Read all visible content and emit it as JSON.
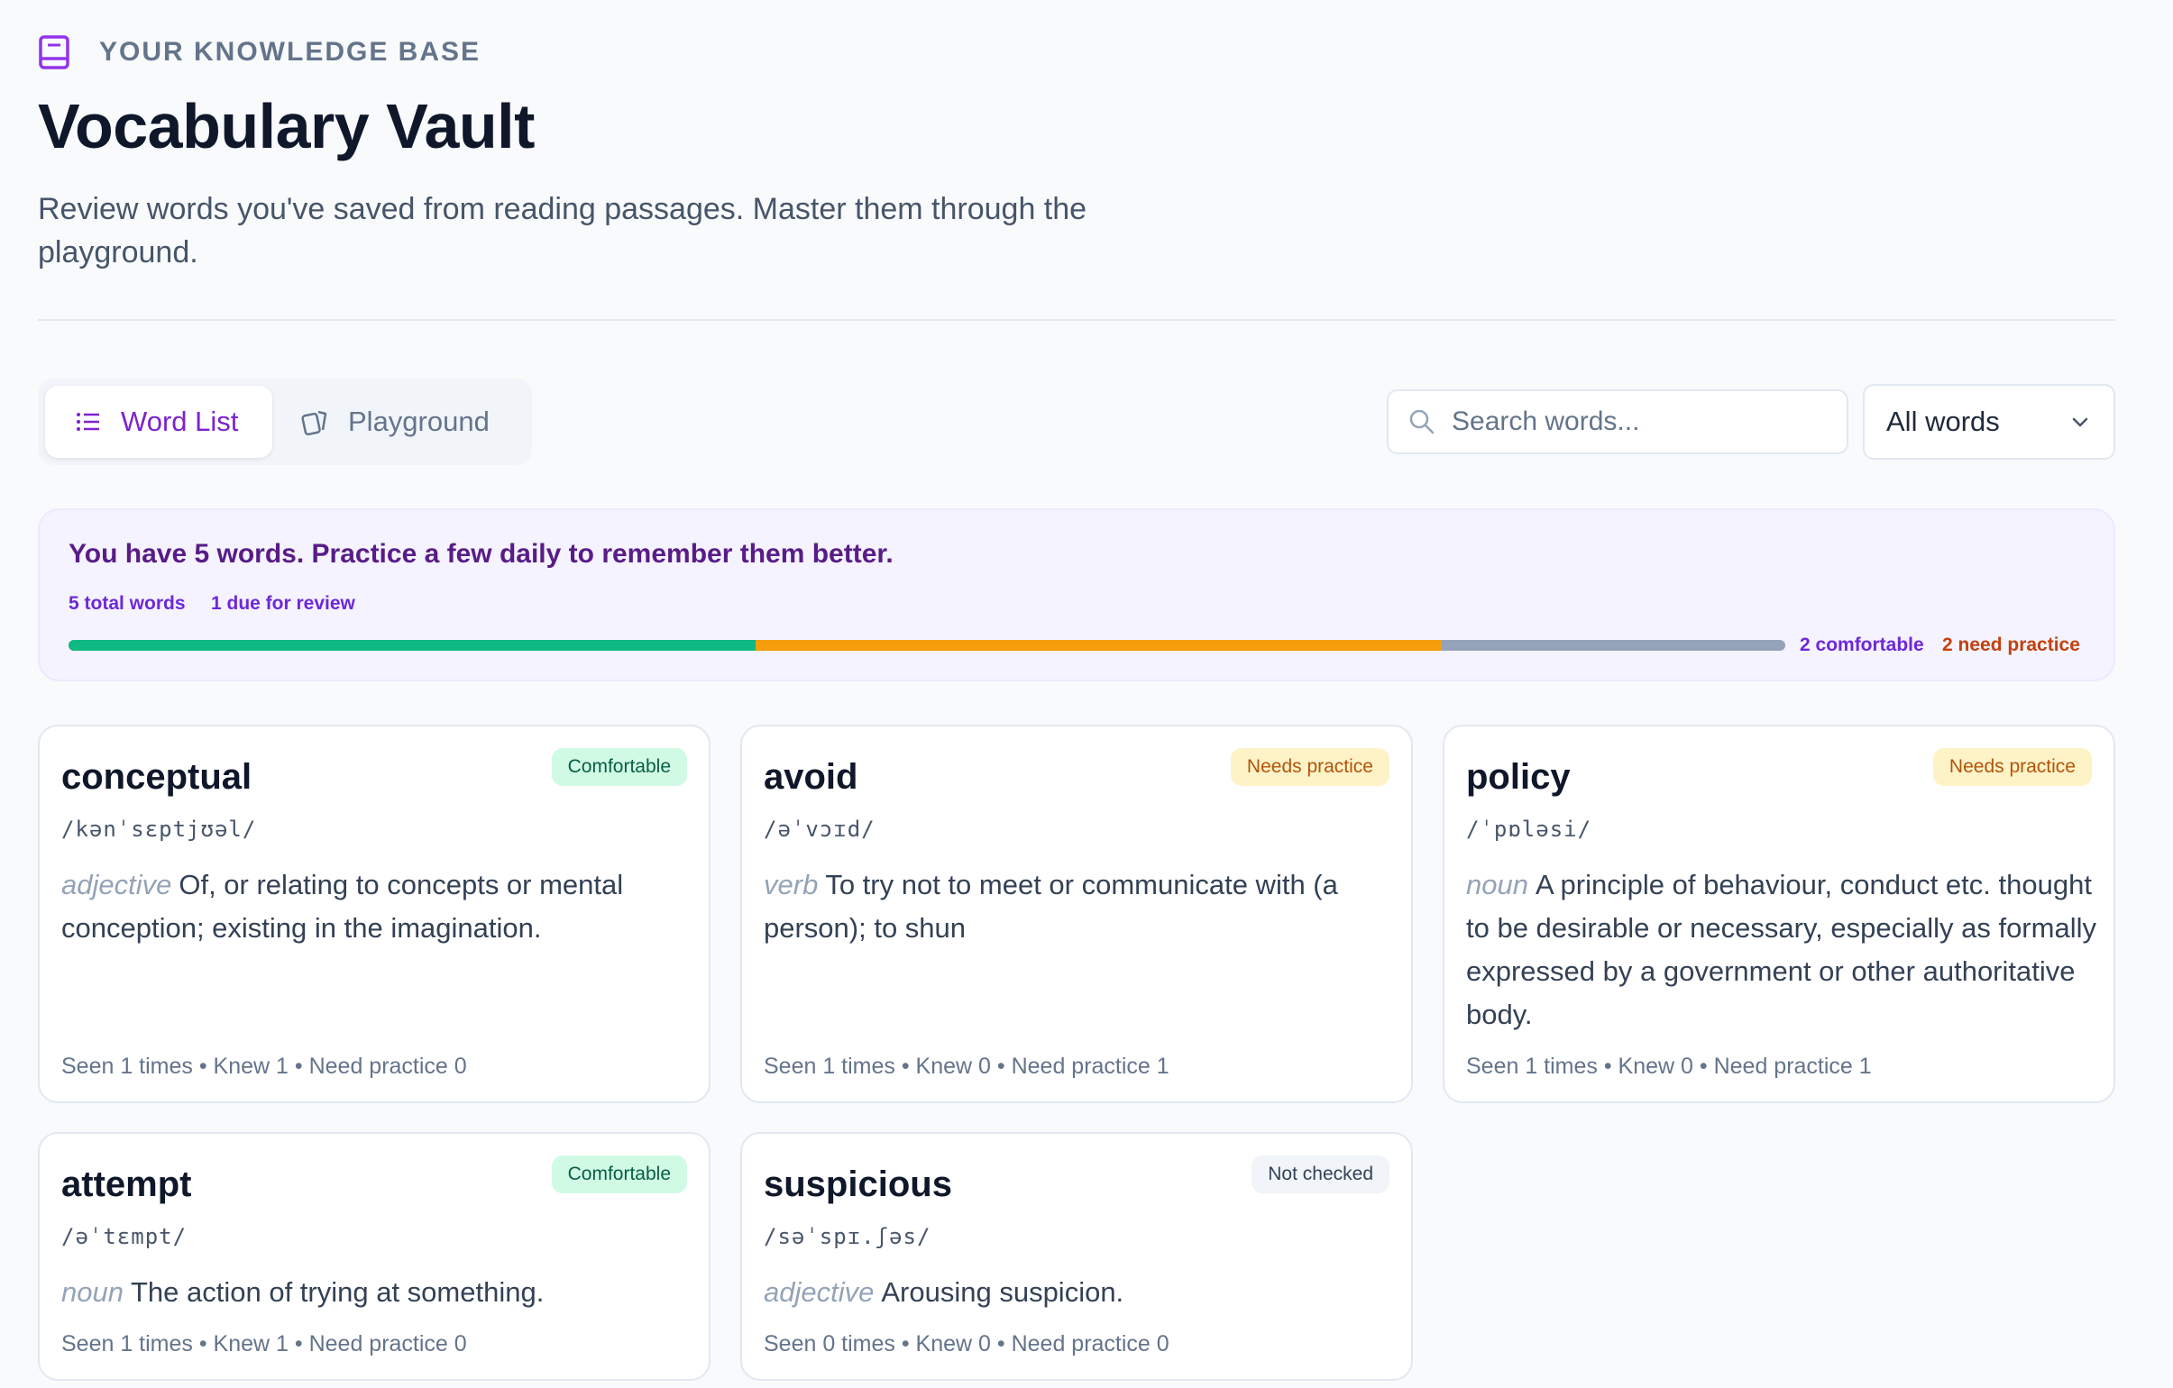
{
  "header": {
    "eyebrow": "YOUR KNOWLEDGE BASE",
    "title": "Vocabulary Vault",
    "subtitle": "Review words you've saved from reading passages. Master them through the playground."
  },
  "tabs": [
    {
      "label": "Word List",
      "icon": "list-icon",
      "active": true
    },
    {
      "label": "Playground",
      "icon": "cards-icon",
      "active": false
    }
  ],
  "search": {
    "placeholder": "Search words..."
  },
  "filter": {
    "selected": "All words"
  },
  "summary": {
    "message": "You have 5 words. Practice a few daily to remember them better.",
    "total_label": "5 total words",
    "due_label": "1 due for review",
    "comfortable_label": "2 comfortable",
    "need_practice_label": "2 need practice",
    "progress": {
      "comfortable": 2,
      "need_practice": 2,
      "not_checked": 1,
      "total": 5
    }
  },
  "colors": {
    "accent": "#7e22ce",
    "comfortable": "#10b981",
    "need_practice": "#f59e0b",
    "not_checked": "#94a3b8"
  },
  "cards": [
    {
      "word": "conceptual",
      "ipa": "/kənˈsɛptjʊəl/",
      "pos": "adjective",
      "definition": "Of, or relating to concepts or mental conception; existing in the imagination.",
      "status": "Comfortable",
      "meta": "Seen 1 times • Knew 1 • Need practice 0"
    },
    {
      "word": "avoid",
      "ipa": "/əˈvɔɪd/",
      "pos": "verb",
      "definition": "To try not to meet or communicate with (a person); to shun",
      "status": "Needs practice",
      "meta": "Seen 1 times • Knew 0 • Need practice 1"
    },
    {
      "word": "policy",
      "ipa": "/ˈpɒləsi/",
      "pos": "noun",
      "definition": "A principle of behaviour, conduct etc. thought to be desirable or necessary, especially as formally expressed by a government or other authoritative body.",
      "status": "Needs practice",
      "meta": "Seen 1 times • Knew 0 • Need practice 1"
    },
    {
      "word": "attempt",
      "ipa": "/əˈtɛmpt/",
      "pos": "noun",
      "definition": "The action of trying at something.",
      "status": "Comfortable",
      "meta": "Seen 1 times • Knew 1 • Need practice 0"
    },
    {
      "word": "suspicious",
      "ipa": "/səˈspɪ.ʃəs/",
      "pos": "adjective",
      "definition": "Arousing suspicion.",
      "status": "Not checked",
      "meta": "Seen 0 times • Knew 0 • Need practice 0"
    }
  ]
}
